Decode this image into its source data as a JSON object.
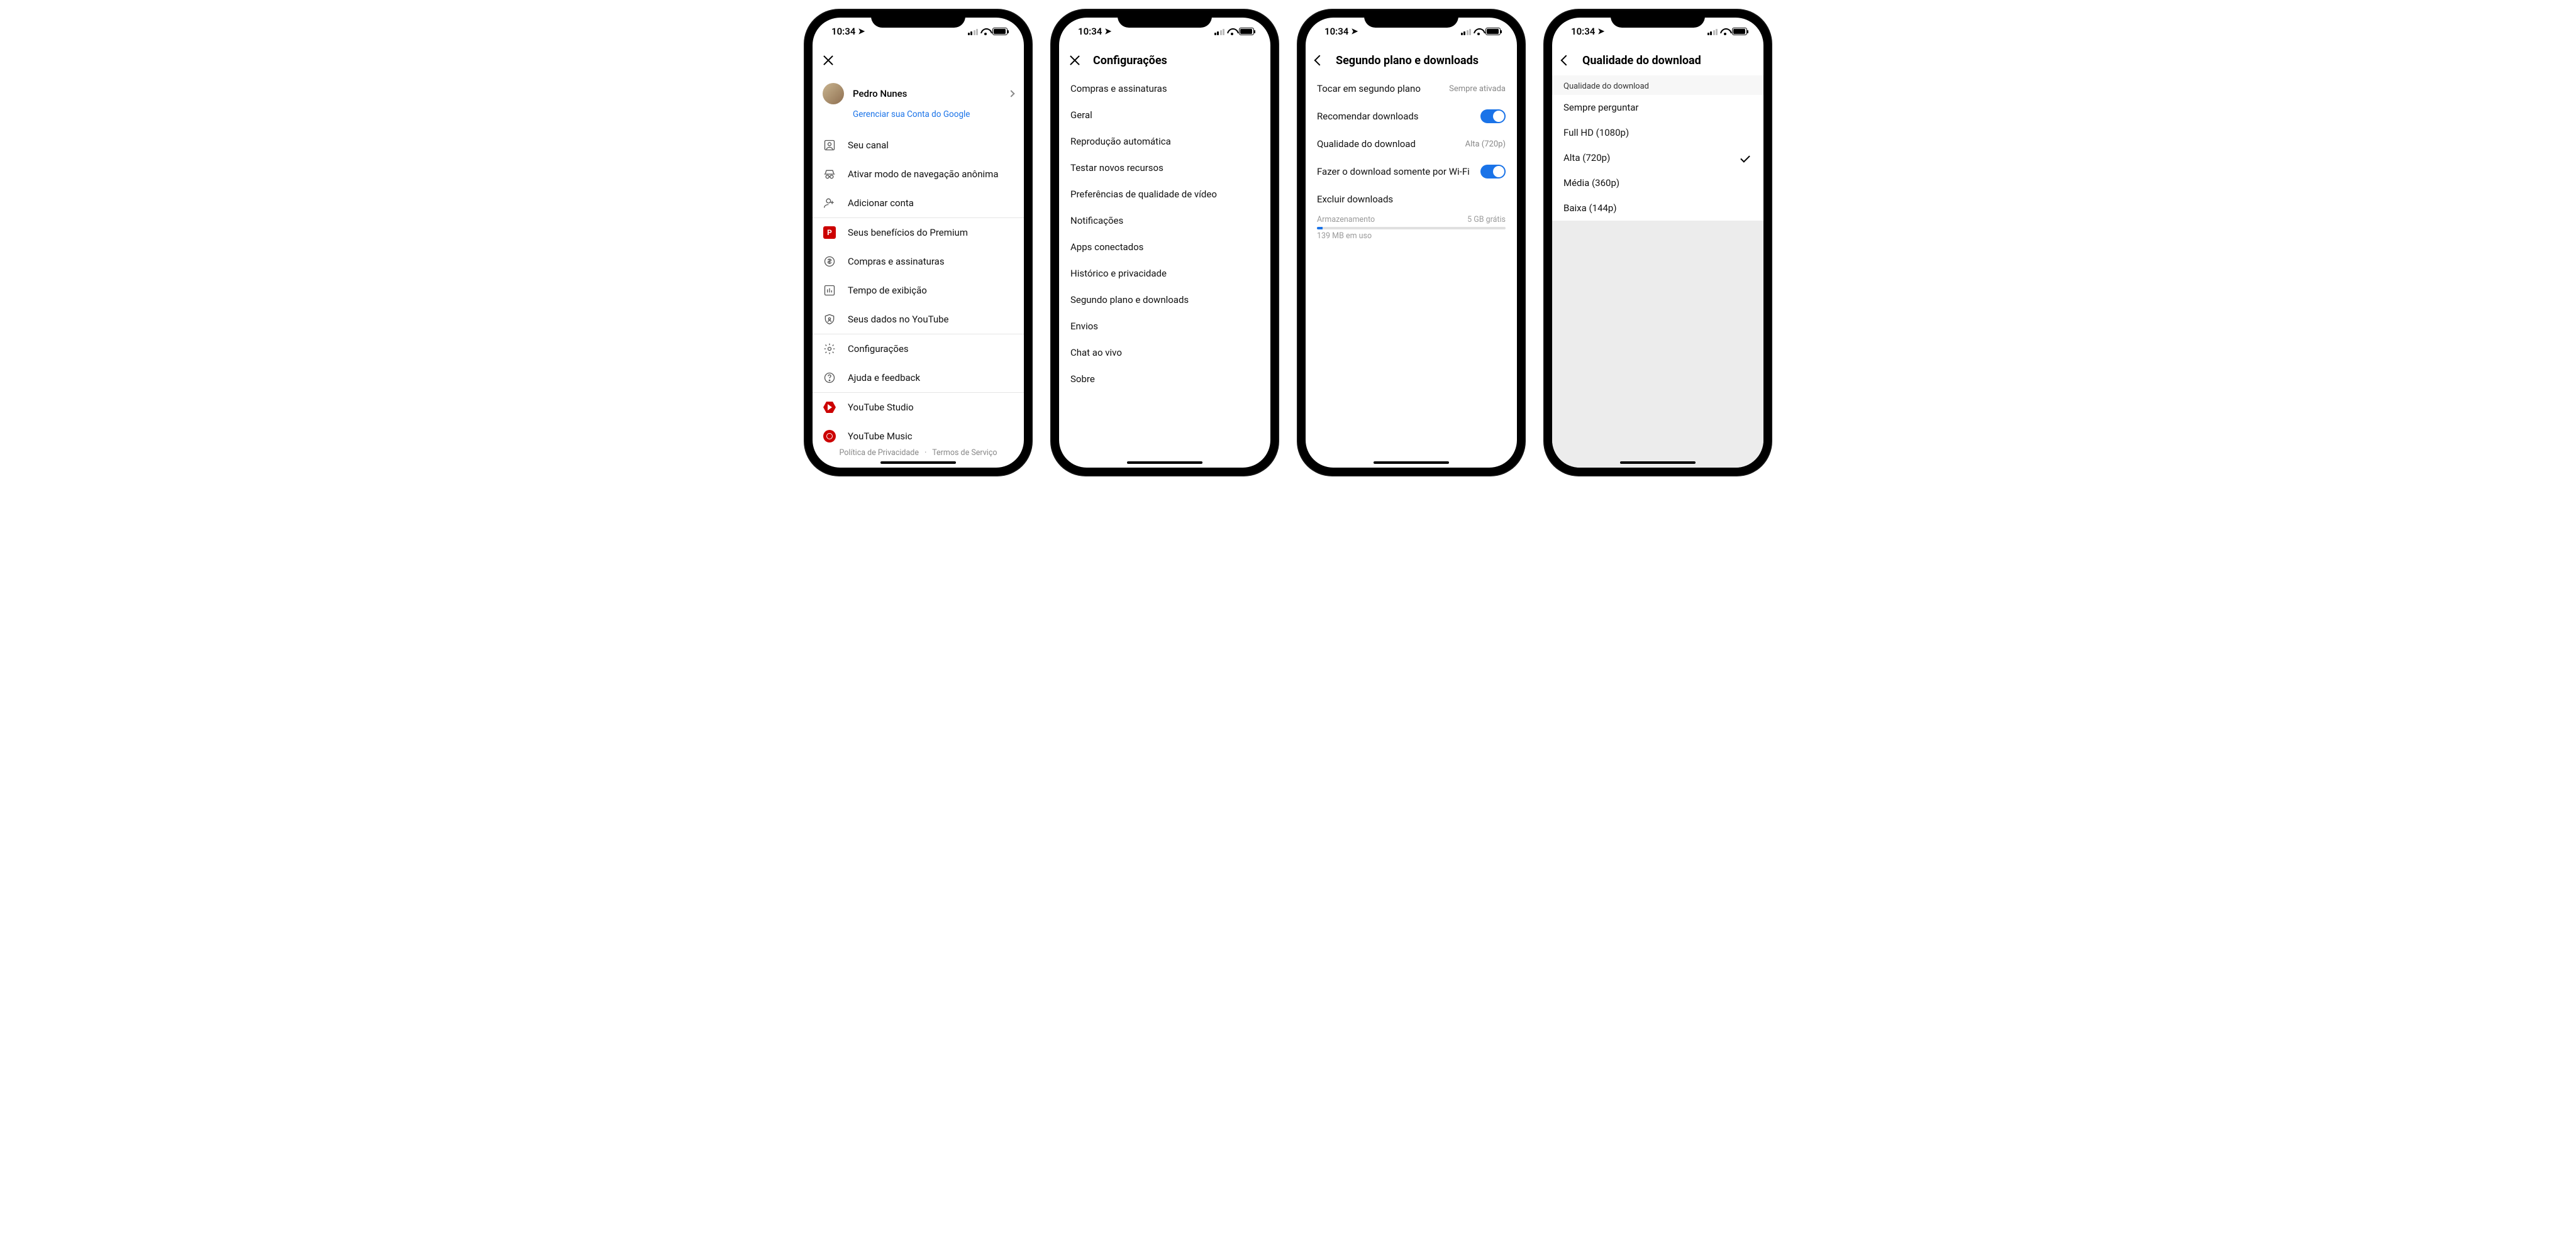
{
  "status": {
    "time": "10:34"
  },
  "phone1": {
    "user_name": "Pedro Nunes",
    "manage_link": "Gerenciar sua Conta do Google",
    "section1": [
      {
        "label": "Seu canal"
      },
      {
        "label": "Ativar modo de navegação anônima"
      },
      {
        "label": "Adicionar conta"
      }
    ],
    "section2": [
      {
        "label": "Seus benefícios do Premium"
      },
      {
        "label": "Compras e assinaturas"
      },
      {
        "label": "Tempo de exibição"
      },
      {
        "label": "Seus dados no YouTube"
      }
    ],
    "section3": [
      {
        "label": "Configurações"
      },
      {
        "label": "Ajuda e feedback"
      }
    ],
    "section4": [
      {
        "label": "YouTube Studio"
      },
      {
        "label": "YouTube Music"
      }
    ],
    "footer": {
      "privacy": "Política de Privacidade",
      "terms": "Termos de Serviço"
    }
  },
  "phone2": {
    "title": "Configurações",
    "items": [
      "Compras e assinaturas",
      "Geral",
      "Reprodução automática",
      "Testar novos recursos",
      "Preferências de qualidade de vídeo",
      "Notificações",
      "Apps conectados",
      "Histórico e privacidade",
      "Segundo plano e downloads",
      "Envios",
      "Chat ao vivo",
      "Sobre"
    ]
  },
  "phone3": {
    "title": "Segundo plano e downloads",
    "row_bg": {
      "label": "Tocar em segundo plano",
      "value": "Sempre ativada"
    },
    "row_rec": {
      "label": "Recomendar downloads"
    },
    "row_quality": {
      "label": "Qualidade do download",
      "value": "Alta (720p)"
    },
    "row_wifi": {
      "label": "Fazer o download somente por Wi-Fi"
    },
    "row_delete": {
      "label": "Excluir downloads"
    },
    "storage": {
      "label": "Armazenamento",
      "free": "5 GB grátis",
      "used": "139 MB em uso"
    }
  },
  "phone4": {
    "title": "Qualidade do download",
    "section_header": "Qualidade do download",
    "options": [
      {
        "label": "Sempre perguntar",
        "selected": false
      },
      {
        "label": "Full HD (1080p)",
        "selected": false
      },
      {
        "label": "Alta (720p)",
        "selected": true
      },
      {
        "label": "Média (360p)",
        "selected": false
      },
      {
        "label": "Baixa (144p)",
        "selected": false
      }
    ]
  }
}
